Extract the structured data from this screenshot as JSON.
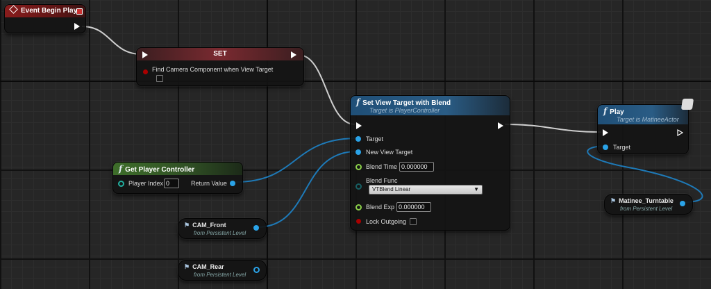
{
  "nodes": {
    "event_begin_play": {
      "title": "Event Begin Play"
    },
    "set": {
      "title": "SET",
      "property": "Find Camera Component when View Target"
    },
    "set_view_target": {
      "title": "Set View Target with Blend",
      "subtitle": "Target is PlayerController",
      "pins": {
        "target": "Target",
        "new_view_target": "New View Target",
        "blend_time": "Blend Time",
        "blend_time_value": "0.000000",
        "blend_func": "Blend Func",
        "blend_func_value": "VTBlend Linear",
        "blend_exp": "Blend Exp",
        "blend_exp_value": "0.000000",
        "lock_outgoing": "Lock Outgoing"
      }
    },
    "play": {
      "title": "Play",
      "subtitle": "Target is MatineeActor",
      "target": "Target"
    },
    "get_player_controller": {
      "title": "Get Player Controller",
      "player_index": "Player Index",
      "player_index_value": "0",
      "return_value": "Return Value"
    },
    "cam_front": {
      "title": "CAM_Front",
      "subtitle": "from Persistent Level"
    },
    "cam_rear": {
      "title": "CAM_Rear",
      "subtitle": "from Persistent Level"
    },
    "matinee": {
      "title": "Matinee_Turntable",
      "subtitle": "from Persistent Level"
    }
  },
  "colors": {
    "object_pin": "#2aa3e8",
    "float_pin": "#8cd24a",
    "byte_pin": "#176064",
    "bool_pin": "#aa0000",
    "exec_pin": "#ffffff"
  },
  "icons": {
    "event": "diamond-event-icon",
    "function": "function-f-icon",
    "variable": "actor-variable-icon"
  }
}
